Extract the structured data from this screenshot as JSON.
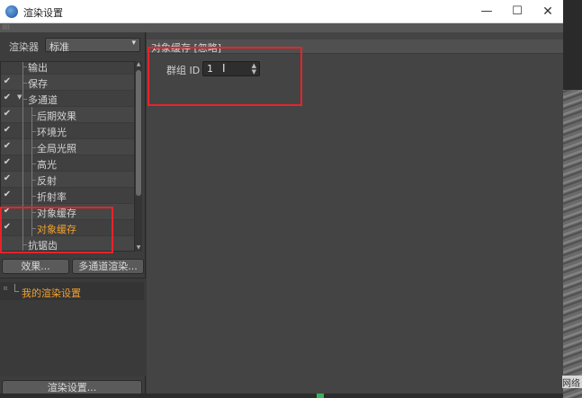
{
  "window": {
    "title": "渲染设置",
    "minimize_glyph": "—",
    "maximize_glyph": "☐",
    "close_glyph": "✕"
  },
  "renderer": {
    "label": "渲染器",
    "value": "标准"
  },
  "tree": {
    "items": [
      {
        "label": "输出",
        "checked": false,
        "level": 0,
        "expander": false,
        "highlight": false
      },
      {
        "label": "保存",
        "checked": true,
        "level": 0,
        "expander": false,
        "highlight": false
      },
      {
        "label": "多通道",
        "checked": true,
        "level": 0,
        "expander": true,
        "highlight": false
      },
      {
        "label": "后期效果",
        "checked": true,
        "level": 1,
        "expander": false,
        "highlight": false
      },
      {
        "label": "环境光",
        "checked": true,
        "level": 1,
        "expander": false,
        "highlight": false
      },
      {
        "label": "全局光照",
        "checked": true,
        "level": 1,
        "expander": false,
        "highlight": false
      },
      {
        "label": "高光",
        "checked": true,
        "level": 1,
        "expander": false,
        "highlight": false
      },
      {
        "label": "反射",
        "checked": true,
        "level": 1,
        "expander": false,
        "highlight": false
      },
      {
        "label": "折射率",
        "checked": true,
        "level": 1,
        "expander": false,
        "highlight": false
      },
      {
        "label": "对象缓存",
        "checked": true,
        "level": 1,
        "expander": false,
        "highlight": false
      },
      {
        "label": "对象缓存",
        "checked": true,
        "level": 1,
        "expander": false,
        "highlight": true
      },
      {
        "label": "抗锯齿",
        "checked": false,
        "level": 0,
        "expander": false,
        "highlight": false
      }
    ]
  },
  "buttons": {
    "effect": "效果...",
    "multipass": "多通道渲染...",
    "render_settings": "渲染设置..."
  },
  "settings_list": {
    "item": "我的渲染设置"
  },
  "panel": {
    "title": "对象缓存 [忽略]",
    "param_label": "群组 ID",
    "param_value": "1"
  },
  "watermark": {
    "text": "网络"
  },
  "colors": {
    "highlight_text": "#f0a030",
    "annotation": "#e8232a"
  }
}
